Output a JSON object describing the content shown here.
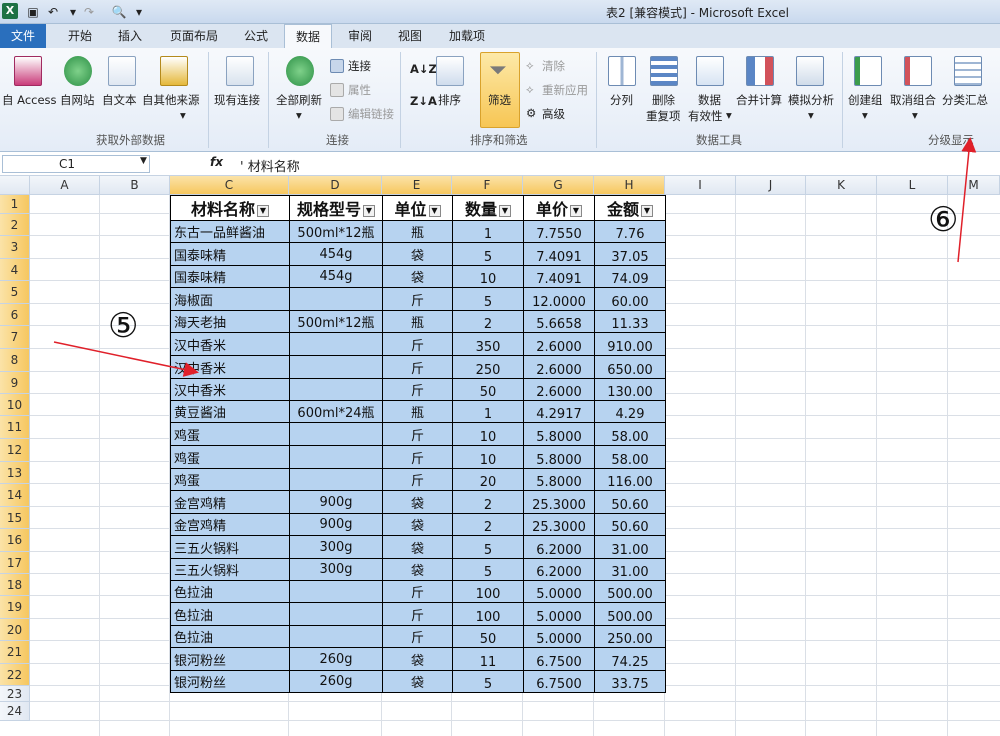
{
  "window": {
    "title": "表2  [兼容模式]  -  Microsoft Excel"
  },
  "tabs": [
    "文件",
    "开始",
    "插入",
    "页面布局",
    "公式",
    "数据",
    "审阅",
    "视图",
    "加载项"
  ],
  "ribbon": {
    "get_external": {
      "access": "自 Access",
      "web": "自网站",
      "text": "自文本",
      "other": "自其他来源",
      "existing": "现有连接",
      "title": "获取外部数据"
    },
    "connections": {
      "refresh_all": "全部刷新",
      "connections": "连接",
      "properties": "属性",
      "edit_links": "编辑链接",
      "title": "连接"
    },
    "sort_filter": {
      "sort": "排序",
      "filter": "筛选",
      "clear": "清除",
      "reapply": "重新应用",
      "advanced": "高级",
      "title": "排序和筛选"
    },
    "data_tools": {
      "text_to_columns": "分列",
      "remove_dup_1": "删除",
      "remove_dup_2": "重复项",
      "validation_1": "数据",
      "validation_2": "有效性",
      "consolidate": "合并计算",
      "whatif": "模拟分析",
      "title": "数据工具"
    },
    "outline": {
      "group": "创建组",
      "ungroup": "取消组合",
      "subtotal": "分类汇总",
      "title": "分级显示"
    }
  },
  "formula_bar": {
    "name_box": "C1",
    "fx": "fx",
    "content": "' 材料名称"
  },
  "columns": [
    "A",
    "B",
    "C",
    "D",
    "E",
    "F",
    "G",
    "H",
    "I",
    "J",
    "K",
    "L",
    "M"
  ],
  "rows": [
    "1",
    "2",
    "3",
    "4",
    "5",
    "6",
    "7",
    "8",
    "9",
    "10",
    "11",
    "12",
    "13",
    "14",
    "15",
    "16",
    "17",
    "18",
    "19",
    "20",
    "21",
    "22",
    "23",
    "24"
  ],
  "table": {
    "headers": [
      "材料名称",
      "规格型号",
      "单位",
      "数量",
      "单价",
      "金额"
    ],
    "rows": [
      [
        "东古一品鲜酱油",
        "500ml*12瓶",
        "瓶",
        "1",
        "7.7550",
        "7.76"
      ],
      [
        "国泰味精",
        "454g",
        "袋",
        "5",
        "7.4091",
        "37.05"
      ],
      [
        "国泰味精",
        "454g",
        "袋",
        "10",
        "7.4091",
        "74.09"
      ],
      [
        "海椒面",
        "",
        "斤",
        "5",
        "12.0000",
        "60.00"
      ],
      [
        "海天老抽",
        "500ml*12瓶",
        "瓶",
        "2",
        "5.6658",
        "11.33"
      ],
      [
        "汉中香米",
        "",
        "斤",
        "350",
        "2.6000",
        "910.00"
      ],
      [
        "汉中香米",
        "",
        "斤",
        "250",
        "2.6000",
        "650.00"
      ],
      [
        "汉中香米",
        "",
        "斤",
        "50",
        "2.6000",
        "130.00"
      ],
      [
        "黄豆酱油",
        "600ml*24瓶",
        "瓶",
        "1",
        "4.2917",
        "4.29"
      ],
      [
        "鸡蛋",
        "",
        "斤",
        "10",
        "5.8000",
        "58.00"
      ],
      [
        "鸡蛋",
        "",
        "斤",
        "10",
        "5.8000",
        "58.00"
      ],
      [
        "鸡蛋",
        "",
        "斤",
        "20",
        "5.8000",
        "116.00"
      ],
      [
        "金宫鸡精",
        "900g",
        "袋",
        "2",
        "25.3000",
        "50.60"
      ],
      [
        "金宫鸡精",
        "900g",
        "袋",
        "2",
        "25.3000",
        "50.60"
      ],
      [
        "三五火锅料",
        "300g",
        "袋",
        "5",
        "6.2000",
        "31.00"
      ],
      [
        "三五火锅料",
        "300g",
        "袋",
        "5",
        "6.2000",
        "31.00"
      ],
      [
        "色拉油",
        "",
        "斤",
        "100",
        "5.0000",
        "500.00"
      ],
      [
        "色拉油",
        "",
        "斤",
        "100",
        "5.0000",
        "500.00"
      ],
      [
        "色拉油",
        "",
        "斤",
        "50",
        "5.0000",
        "250.00"
      ],
      [
        "银河粉丝",
        "260g",
        "袋",
        "11",
        "6.7500",
        "74.25"
      ],
      [
        "银河粉丝",
        "260g",
        "袋",
        "5",
        "6.7500",
        "33.75"
      ]
    ]
  },
  "annotations": {
    "step5": "⑤",
    "step6": "⑥"
  },
  "colors": {
    "selection_fill": "#b7d3f0",
    "arrow": "#e0202a",
    "file_tab": "#2a6fbd"
  }
}
